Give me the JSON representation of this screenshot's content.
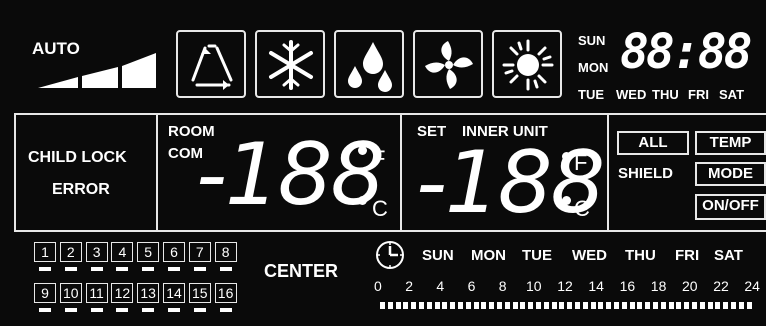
{
  "mode_label": "AUTO",
  "icons": [
    "cycle-icon",
    "snowflake-icon",
    "drops-icon",
    "fan-icon",
    "sun-icon"
  ],
  "clock": {
    "days_left": [
      "SUN",
      "MON",
      "TUE"
    ],
    "days_bottom": [
      "WED",
      "THU",
      "FRI",
      "SAT"
    ],
    "digits": "88:88"
  },
  "status": {
    "child_lock": "CHILD LOCK",
    "error": "ERROR"
  },
  "room": {
    "room_label": "ROOM",
    "com_label": "COM",
    "value": "-188",
    "unit_f": "F",
    "unit_c": "C"
  },
  "setpoint": {
    "set_label": "SET",
    "inner_label": "INNER UNIT",
    "value": "-188",
    "unit_f": "F",
    "unit_c": "C"
  },
  "shield": {
    "label": "SHIELD",
    "buttons": [
      "ALL",
      "TEMP",
      "MODE",
      "ON/OFF"
    ]
  },
  "zones": {
    "row1": [
      "1",
      "2",
      "3",
      "4",
      "5",
      "6",
      "7",
      "8"
    ],
    "row2": [
      "9",
      "10",
      "11",
      "12",
      "13",
      "14",
      "15",
      "16"
    ],
    "center_label": "CENTER"
  },
  "schedule": {
    "days": [
      "SUN",
      "MON",
      "TUE",
      "WED",
      "THU",
      "FRI",
      "SAT"
    ],
    "hours": [
      "0",
      "2",
      "4",
      "6",
      "8",
      "10",
      "12",
      "14",
      "16",
      "18",
      "20",
      "22",
      "24"
    ]
  }
}
